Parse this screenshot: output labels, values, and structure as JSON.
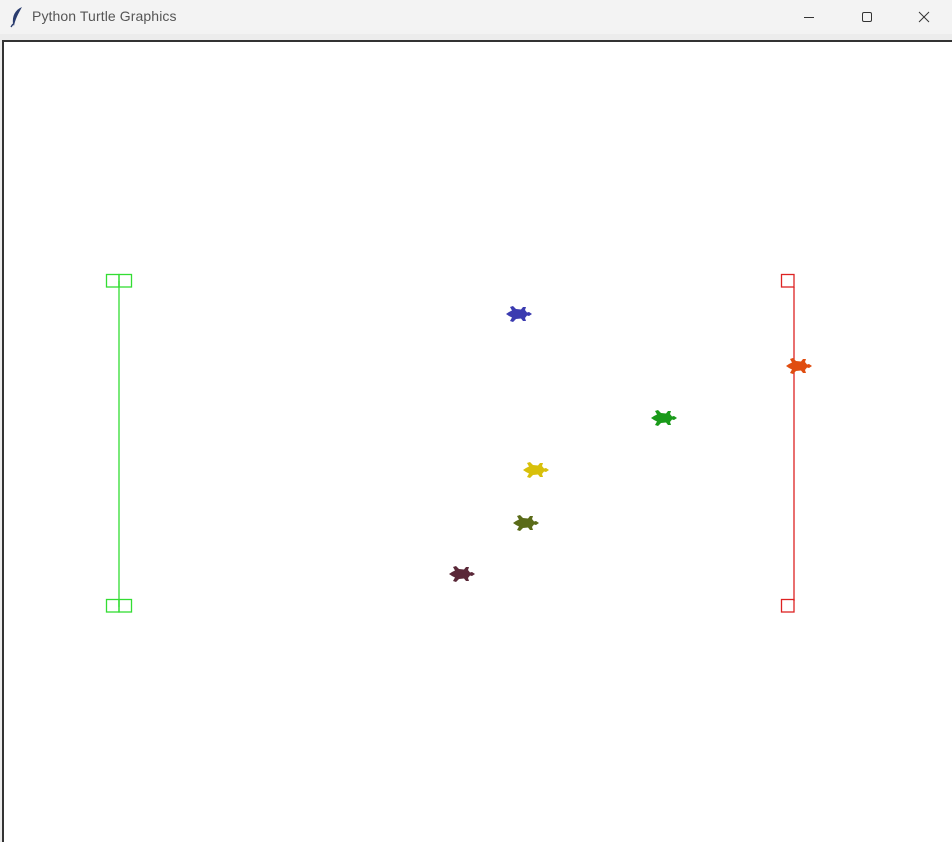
{
  "window": {
    "title": "Python Turtle Graphics",
    "icon": "feather-icon",
    "controls": {
      "minimize_icon": "minimize-icon",
      "maximize_icon": "maximize-icon",
      "close_icon": "close-icon"
    }
  },
  "canvas": {
    "background": "#ffffff",
    "start_line": {
      "color": "#33dd33",
      "style": "double-square-caps"
    },
    "finish_line": {
      "color": "#dd2222",
      "style": "single-square-caps"
    },
    "turtles": [
      {
        "name": "blue",
        "color": "#3b3bb0"
      },
      {
        "name": "orange",
        "color": "#e04d10"
      },
      {
        "name": "green",
        "color": "#1a9a1a"
      },
      {
        "name": "yellow",
        "color": "#d8c00a"
      },
      {
        "name": "olive",
        "color": "#5a6b18"
      },
      {
        "name": "maroon",
        "color": "#5a2838"
      }
    ]
  }
}
